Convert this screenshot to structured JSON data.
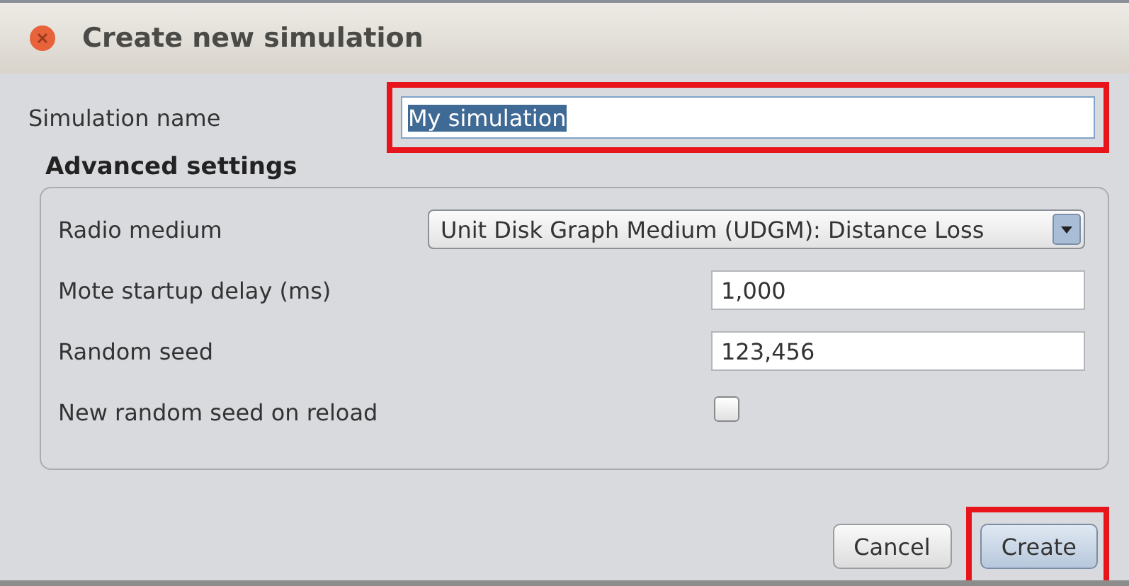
{
  "window": {
    "title": "Create new simulation"
  },
  "name_field": {
    "label": "Simulation name",
    "value": "My simulation",
    "text_selected": true,
    "highlighted": true
  },
  "advanced": {
    "title": "Advanced settings",
    "rows": [
      {
        "kind": "dropdown",
        "label": "Radio medium",
        "value": "Unit Disk Graph Medium (UDGM): Distance Loss"
      },
      {
        "kind": "text",
        "label": "Mote startup delay (ms)",
        "value": "1,000"
      },
      {
        "kind": "text",
        "label": "Random seed",
        "value": "123,456"
      },
      {
        "kind": "checkbox",
        "label": "New random seed on reload",
        "checked": false
      }
    ]
  },
  "buttons": [
    {
      "label": "Cancel",
      "default": false,
      "highlighted": false
    },
    {
      "label": "Create",
      "default": true,
      "highlighted": true
    }
  ]
}
